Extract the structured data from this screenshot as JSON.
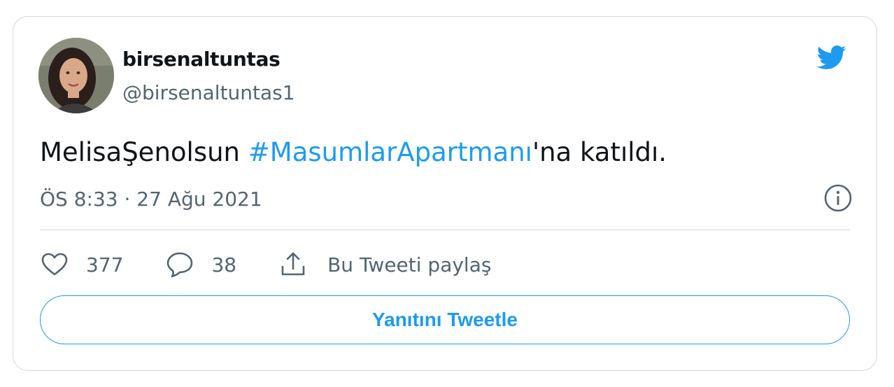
{
  "author": {
    "display_name": "birsenaltuntas",
    "handle": "@birsenaltuntas1"
  },
  "tweet": {
    "text_before": "MelisaŞenolsun ",
    "hashtag": "#MasumlarApartmanı",
    "text_after": "'na katıldı.",
    "timestamp": "ÖS 8:33 · 27 Ağu 2021"
  },
  "actions": {
    "likes_count": "377",
    "replies_count": "38",
    "share_label": "Bu Tweeti paylaş"
  },
  "reply_button_label": "Yanıtını Tweetle",
  "icons": {
    "logo": "twitter-bird-icon",
    "info": "info-icon",
    "like": "heart-icon",
    "reply": "speech-bubble-icon",
    "share": "share-upload-icon"
  },
  "colors": {
    "accent": "#1d9bf0",
    "text_primary": "#0f1419",
    "text_secondary": "#536471",
    "border": "#cfd9de"
  }
}
